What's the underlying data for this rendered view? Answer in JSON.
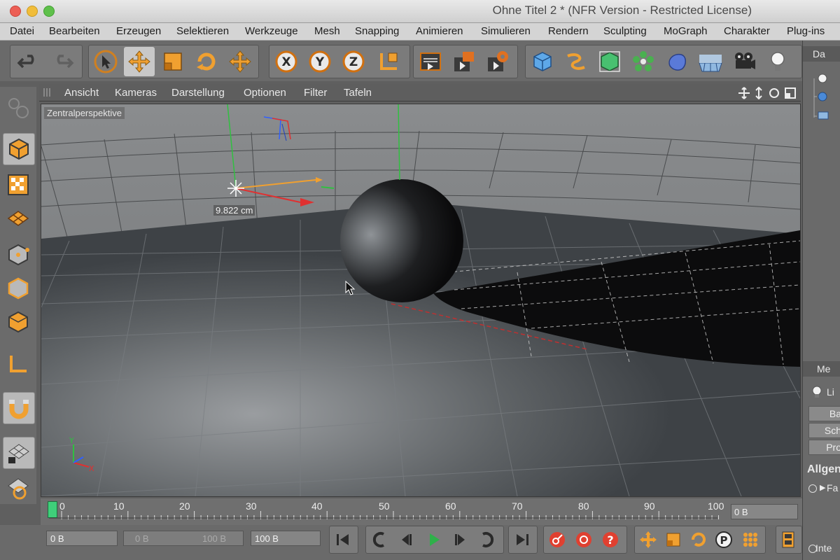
{
  "window": {
    "title": "Ohne Titel 2 * (NFR Version - Restricted License)"
  },
  "menubar": {
    "items": [
      "Datei",
      "Bearbeiten",
      "Erzeugen",
      "Selektieren",
      "Werkzeuge",
      "Mesh",
      "Snapping",
      "Animieren",
      "Simulieren",
      "Rendern",
      "Sculpting",
      "MoGraph",
      "Charakter",
      "Plug-ins"
    ]
  },
  "viewport": {
    "menu": [
      "Ansicht",
      "Kameras",
      "Darstellung",
      "Optionen",
      "Filter",
      "Tafeln"
    ],
    "camera_label": "Zentralperspektive",
    "measurement": "9.822 cm",
    "axis_labels": {
      "x": "X",
      "y": "Y"
    }
  },
  "toolbar": {
    "icons": [
      "undo-icon",
      "redo-icon",
      "select-arrow-icon",
      "move-icon",
      "scale-icon",
      "rotate-icon",
      "live-select-icon",
      "x-axis-lock-icon",
      "y-axis-lock-icon",
      "z-axis-lock-icon",
      "coordinate-system-icon",
      "render-view-icon",
      "render-picture-viewer-icon",
      "render-settings-icon",
      "cube-object-icon",
      "spline-icon",
      "subdivision-icon",
      "array-icon",
      "deformer-icon",
      "floor-icon",
      "camera-icon",
      "light-icon"
    ]
  },
  "left_toolbar": {
    "icons": [
      "model-mode-icon",
      "texture-mode-icon",
      "workplane-icon",
      "points-mode-icon",
      "edges-mode-icon",
      "polygons-mode-icon",
      "axis-mode-icon",
      "magnet-icon",
      "snap-lock-icon",
      "locked-workplane-icon"
    ]
  },
  "right_panel": {
    "top_tab": "Da",
    "mid_tab": "Me",
    "light_label": "Li",
    "subtabs": [
      "Ba",
      "Sch",
      "Pro"
    ],
    "section": "Allgen",
    "field_fa": "Fa",
    "bottom": "Inte"
  },
  "timeline": {
    "ticks": [
      "0",
      "10",
      "20",
      "30",
      "40",
      "50",
      "60",
      "70",
      "80",
      "90",
      "100"
    ],
    "frame_value": "0 B"
  },
  "playback": {
    "start_field": "0 B",
    "range_min": "0 B",
    "range_max": "100 B",
    "end_field": "100 B"
  },
  "colors": {
    "accent": "#f0a030",
    "x_axis": "#e03030",
    "y_axis": "#30c040",
    "z_axis": "#3060ff"
  }
}
